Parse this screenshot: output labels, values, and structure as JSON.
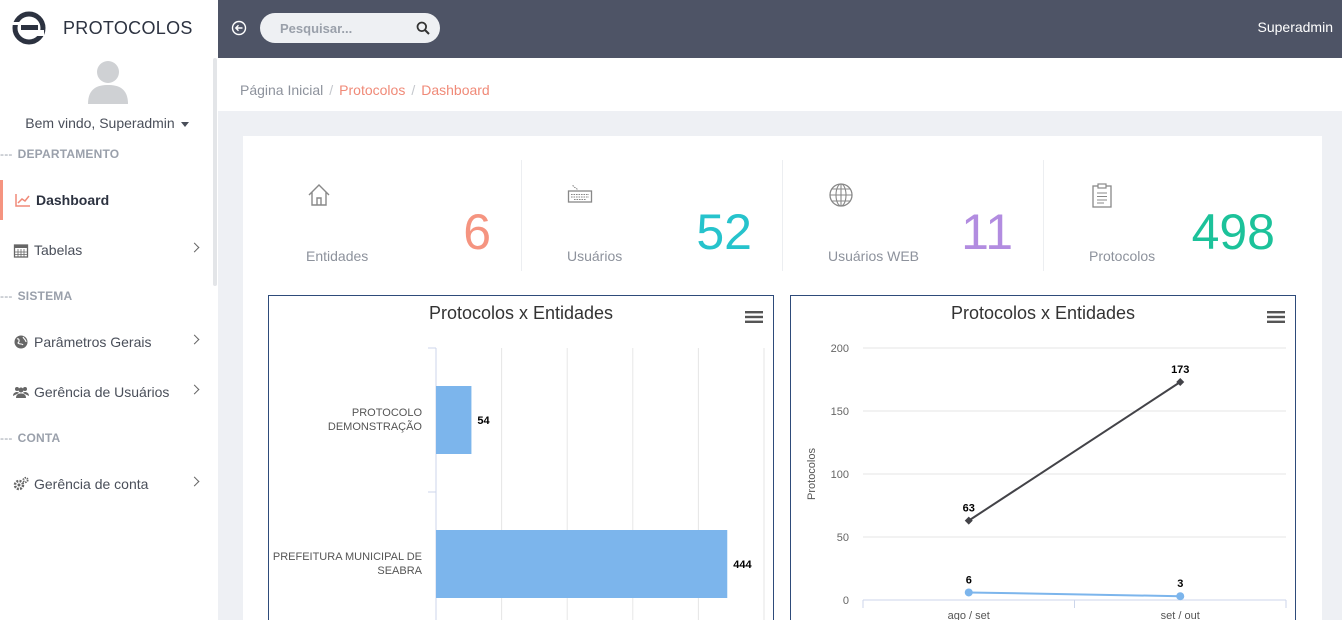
{
  "app": {
    "title": "PROTOCOLOS"
  },
  "user": {
    "welcome": "Bem vindo, Superadmin",
    "name": "Superadmin"
  },
  "search": {
    "placeholder": "Pesquisar..."
  },
  "sidebar": {
    "sections": [
      {
        "dash": "---",
        "label": "DEPARTAMENTO"
      },
      {
        "dash": "---",
        "label": "SISTEMA"
      },
      {
        "dash": "---",
        "label": "CONTA"
      }
    ],
    "items": [
      {
        "label": "Dashboard",
        "icon": "chart-line-icon"
      },
      {
        "label": "Tabelas",
        "icon": "calendar-icon"
      },
      {
        "label": "Parâmetros Gerais",
        "icon": "globe-icon"
      },
      {
        "label": "Gerência de Usuários",
        "icon": "users-icon"
      },
      {
        "label": "Gerência de conta",
        "icon": "gears-icon"
      }
    ]
  },
  "breadcrumb": {
    "home": "Página Inicial",
    "sep": "/",
    "items": [
      "Protocolos",
      "Dashboard"
    ]
  },
  "stats": [
    {
      "label": "Entidades",
      "value": "6",
      "icon": "home-icon",
      "color": "#f59480"
    },
    {
      "label": "Usuários",
      "value": "52",
      "icon": "keyboard-icon",
      "color": "#26c3cc"
    },
    {
      "label": "Usuários WEB",
      "value": "11",
      "icon": "globe-icon",
      "color": "#b28ce0"
    },
    {
      "label": "Protocolos",
      "value": "498",
      "icon": "clipboard-icon",
      "color": "#1cc29a"
    }
  ],
  "chart_data": [
    {
      "type": "bar",
      "orientation": "horizontal",
      "title": "Protocolos x Entidades",
      "categories": [
        [
          "PROTOCOLO",
          "DEMONSTRAÇÃO"
        ],
        [
          "PREFEITURA MUNICIPAL DE",
          "SEABRA"
        ]
      ],
      "values": [
        54,
        444
      ],
      "data_labels": [
        "54",
        "444"
      ],
      "xlim": [
        0,
        500
      ],
      "grid": true,
      "color": "#7cb5ec"
    },
    {
      "type": "line",
      "title": "Protocolos x Entidades",
      "ylabel": "Protocolos",
      "categories": [
        "ago / set",
        "set / out"
      ],
      "yticks": [
        "0",
        "50",
        "100",
        "150",
        "200"
      ],
      "ylim": [
        0,
        200
      ],
      "grid": true,
      "series": [
        {
          "values": [
            63,
            173
          ],
          "labels": [
            "63",
            "173"
          ],
          "color": "#434348"
        },
        {
          "values": [
            6,
            3
          ],
          "labels": [
            "6",
            "3"
          ],
          "color": "#7cb5ec"
        }
      ]
    }
  ]
}
